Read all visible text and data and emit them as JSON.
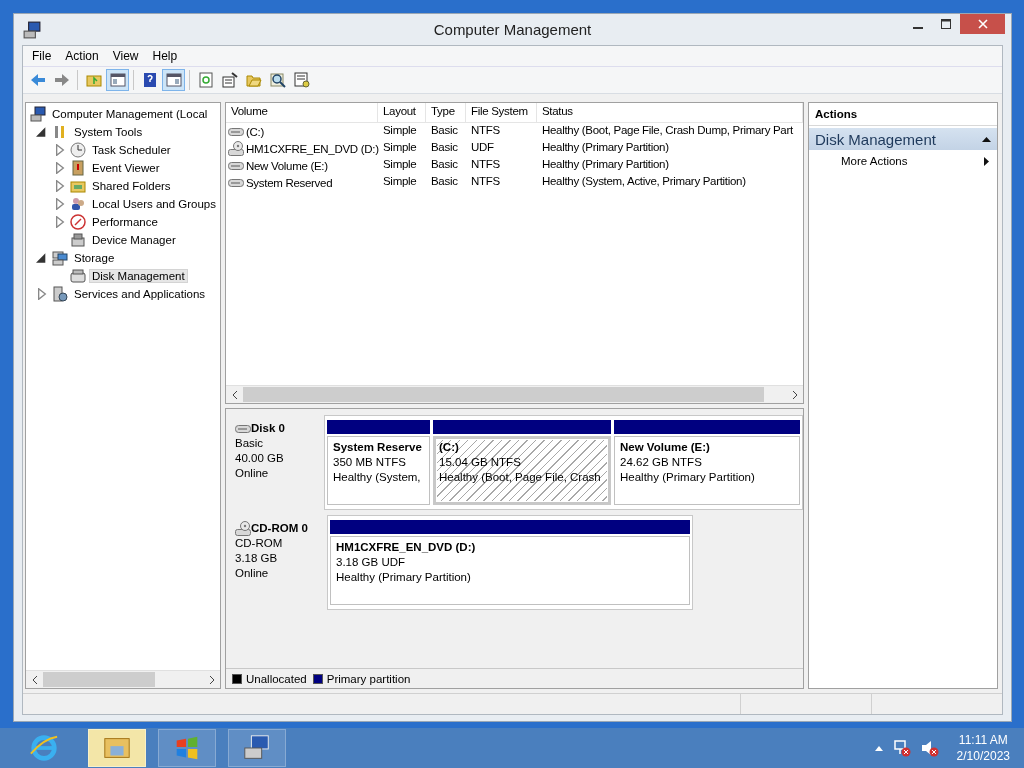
{
  "window": {
    "title": "Computer Management"
  },
  "menu": [
    "File",
    "Action",
    "View",
    "Help"
  ],
  "toolbar": [
    {
      "pressed": false
    },
    {
      "pressed": false
    },
    {
      "pressed": false
    },
    {
      "pressed": true
    },
    {
      "pressed": false
    },
    {
      "pressed": true
    },
    {
      "pressed": false
    },
    {
      "pressed": false
    },
    {
      "pressed": false
    },
    {
      "pressed": false
    },
    {
      "pressed": false
    }
  ],
  "tree": [
    {
      "label": "Computer Management (Local",
      "selected": false,
      "children": [
        {
          "label": "System Tools",
          "expanded": true,
          "selected": false,
          "children": [
            {
              "label": "Task Scheduler",
              "expanded": false,
              "selected": false
            },
            {
              "label": "Event Viewer",
              "expanded": false,
              "selected": false
            },
            {
              "label": "Shared Folders",
              "expanded": false,
              "selected": false
            },
            {
              "label": "Local Users and Groups",
              "expanded": false,
              "selected": false
            },
            {
              "label": "Performance",
              "expanded": false,
              "selected": false
            },
            {
              "label": "Device Manager",
              "selected": false
            }
          ]
        },
        {
          "label": "Storage",
          "expanded": true,
          "selected": false,
          "children": [
            {
              "label": "Disk Management",
              "selected": true
            }
          ]
        },
        {
          "label": "Services and Applications",
          "expanded": false,
          "selected": false
        }
      ]
    }
  ],
  "volumes": {
    "columns": [
      "Volume",
      "Layout",
      "Type",
      "File System",
      "Status"
    ],
    "rows": [
      {
        "kind": "disk",
        "cells": [
          "(C:)",
          "Simple",
          "Basic",
          "NTFS",
          "Healthy (Boot, Page File, Crash Dump, Primary Part"
        ]
      },
      {
        "kind": "cd",
        "cells": [
          "HM1CXFRE_EN_DVD (D:)",
          "Simple",
          "Basic",
          "UDF",
          "Healthy (Primary Partition)"
        ]
      },
      {
        "kind": "disk",
        "cells": [
          "New Volume (E:)",
          "Simple",
          "Basic",
          "NTFS",
          "Healthy (Primary Partition)"
        ]
      },
      {
        "kind": "disk",
        "cells": [
          "System Reserved",
          "Simple",
          "Basic",
          "NTFS",
          "Healthy (System, Active, Primary Partition)"
        ]
      }
    ]
  },
  "disks": [
    {
      "kind": "disk",
      "name": "Disk 0",
      "type": "Basic",
      "size": "40.00 GB",
      "status": "Online",
      "partitions": [
        {
          "label": "System Reserve",
          "detail": "350 MB NTFS",
          "status": "Healthy (System,",
          "selected": false
        },
        {
          "label": "(C:)",
          "detail": "15.04 GB NTFS",
          "status": "Healthy (Boot, Page File, Crash",
          "selected": true
        },
        {
          "label": "New Volume  (E:)",
          "detail": "24.62 GB NTFS",
          "status": "Healthy (Primary Partition)",
          "selected": false
        }
      ]
    },
    {
      "kind": "cd",
      "name": "CD-ROM 0",
      "type": "CD-ROM",
      "size": "3.18 GB",
      "status": "Online",
      "partitions": [
        {
          "label": "HM1CXFRE_EN_DVD  (D:)",
          "detail": "3.18 GB UDF",
          "status": "Healthy (Primary Partition)",
          "selected": false
        }
      ]
    }
  ],
  "legend": [
    {
      "label": "Unallocated",
      "color": "#000000"
    },
    {
      "label": "Primary partition",
      "color": "#000080"
    }
  ],
  "actions": {
    "title": "Actions",
    "section": {
      "label": "Disk Management",
      "expanded": true
    },
    "items": [
      "More Actions"
    ]
  },
  "taskbar": [
    {
      "selected": false
    },
    {
      "selected": true
    },
    {
      "selected": false
    },
    {
      "selected": false
    }
  ],
  "clock": {
    "time": "11:11 AM",
    "date": "2/10/2023"
  }
}
